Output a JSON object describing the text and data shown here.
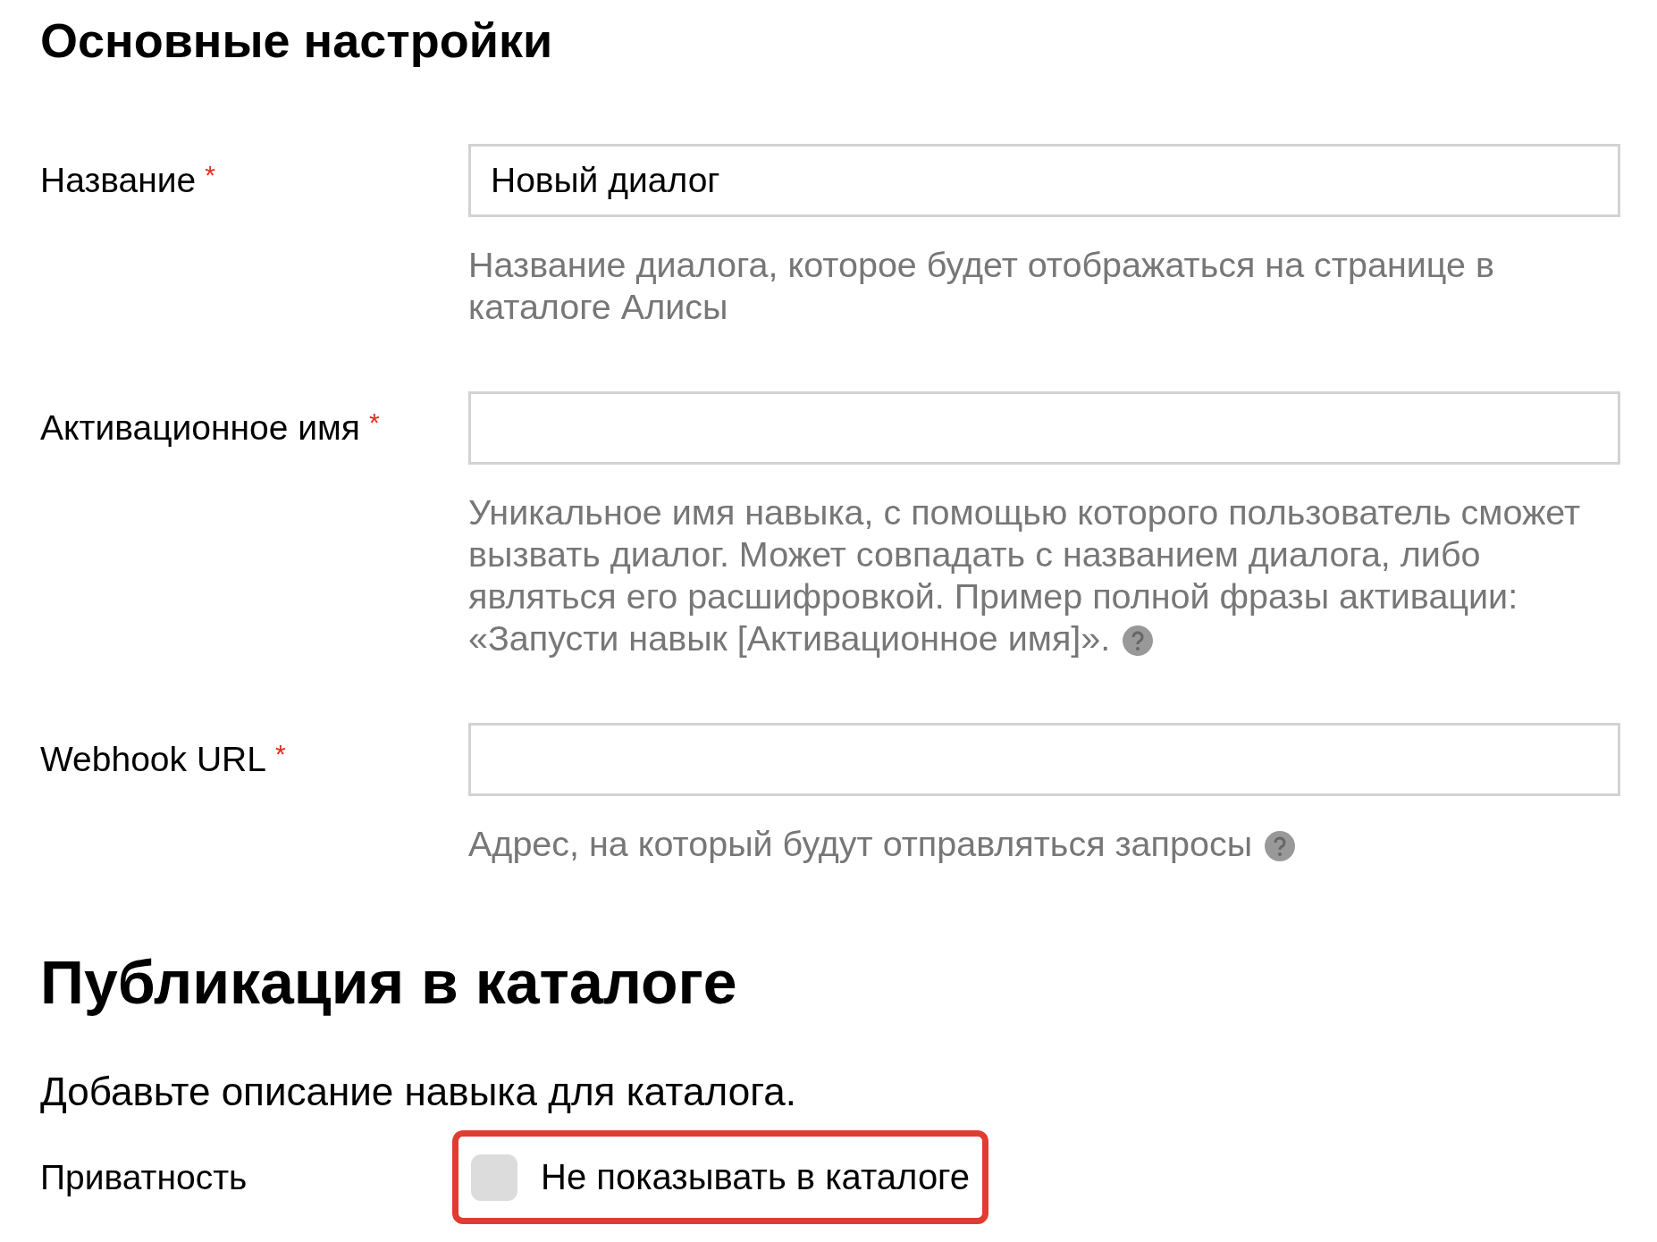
{
  "sections": [
    {
      "title": "Основные настройки",
      "fields": [
        {
          "label": "Название",
          "required_mark": "*",
          "value": "Новый диалог",
          "hint": "Название диалога, которое будет отображаться на странице в каталоге Алисы",
          "help": false
        },
        {
          "label": "Активационное имя",
          "required_mark": "*",
          "hint": "Уникальное имя навыка, с помощью которого пользователь сможет вызвать диалог. Может совпадать с названием диалога, либо являться его расшифровкой. Пример полной фразы активации: «Запусти навык [Активационное имя]».",
          "help": true
        },
        {
          "label": "Webhook URL",
          "required_mark": "*",
          "hint": "Адрес, на который будут отправляться запросы",
          "help": true
        }
      ]
    }
  ],
  "publication": {
    "title": "Публикация в каталоге",
    "description": "Добавьте описание навыка для каталога.",
    "privacy": {
      "label": "Приватность",
      "option": "Не показывать в каталоге",
      "checked": false,
      "highlighted": true
    }
  }
}
